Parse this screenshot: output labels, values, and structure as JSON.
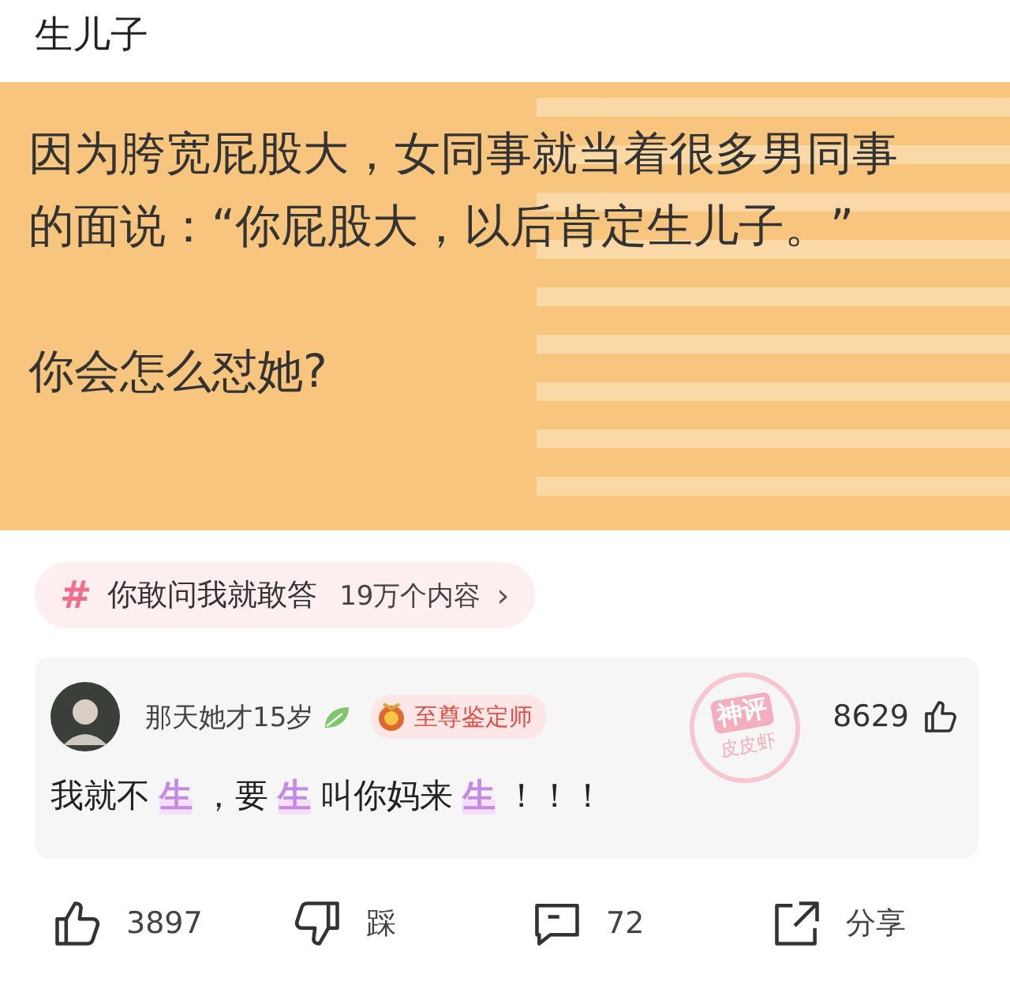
{
  "post": {
    "title": "生儿子",
    "image_text": {
      "lines": [
        "因为胯宽屁股大，女同事就当着很多男同事",
        "的面说：“你屁股大，以后肯定生儿子。”"
      ],
      "question": "你会怎么怼她?"
    }
  },
  "topic": {
    "symbol": "#",
    "name": "你敢问我就敢答",
    "count": "19万个内容",
    "arrow": "›"
  },
  "comment": {
    "username": "那天她才15岁",
    "badge": "至尊鉴定师",
    "likes": "8629",
    "stamp": {
      "top": "神评",
      "bottom": "皮皮虾"
    },
    "segments": [
      {
        "text": "我就不",
        "highlight": false
      },
      {
        "text": "生",
        "highlight": true
      },
      {
        "text": "，要",
        "highlight": false
      },
      {
        "text": "生",
        "highlight": true
      },
      {
        "text": "叫你妈来",
        "highlight": false
      },
      {
        "text": "生",
        "highlight": true
      },
      {
        "text": "！！！",
        "highlight": false
      }
    ]
  },
  "actions": [
    {
      "kind": "like",
      "label": "3897"
    },
    {
      "kind": "dislike",
      "label": "踩"
    },
    {
      "kind": "comment",
      "label": "72"
    },
    {
      "kind": "share",
      "label": "分享"
    }
  ]
}
